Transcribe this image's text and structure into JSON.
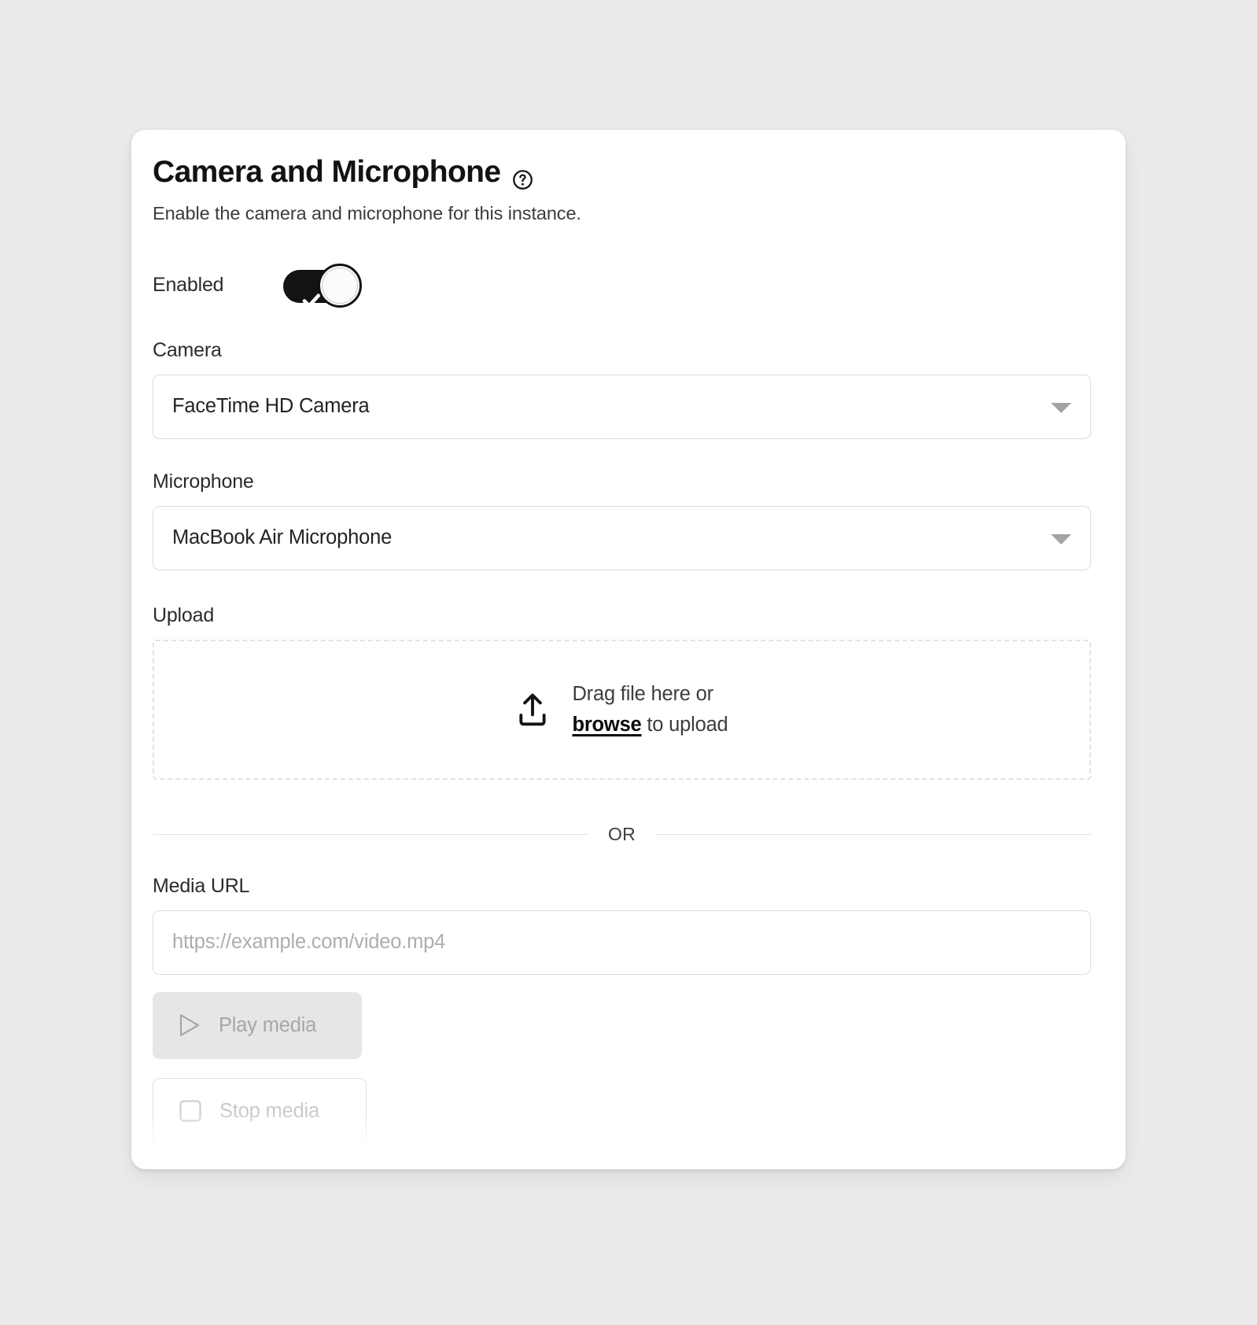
{
  "card": {
    "title": "Camera and Microphone",
    "help_icon": "question-circle-icon",
    "subtitle": "Enable the camera and microphone for this instance."
  },
  "enabled_toggle": {
    "label": "Enabled",
    "state": "on",
    "icon": "check-icon",
    "track_color": "#131313",
    "knob_color": "#fbfbfb"
  },
  "camera": {
    "label": "Camera",
    "value": "FaceTime HD Camera",
    "caret_icon": "chevron-down-icon"
  },
  "microphone": {
    "label": "Microphone",
    "value": "MacBook Air Microphone",
    "caret_icon": "chevron-down-icon"
  },
  "upload": {
    "label": "Upload",
    "icon": "upload-icon",
    "line1": "Drag file here or",
    "browse": "browse",
    "line2_suffix": " to upload"
  },
  "divider": {
    "text": "OR"
  },
  "media_url": {
    "label": "Media URL",
    "value": "",
    "placeholder": "https://example.com/video.mp4"
  },
  "actions": {
    "play": {
      "label": "Play media",
      "icon": "play-triangle-icon",
      "disabled": true,
      "bg": "#e6e6e6",
      "text_color": "#a7a7a7"
    },
    "stop": {
      "label": "Stop media",
      "icon": "stop-square-icon",
      "disabled": true,
      "bg": "#ffffff",
      "text_color": "#c9c9c9"
    }
  },
  "colors": {
    "page_background": "#ebebeb",
    "card_background": "#ffffff",
    "border": "#dcdcdc",
    "muted_text": "#adadad"
  }
}
